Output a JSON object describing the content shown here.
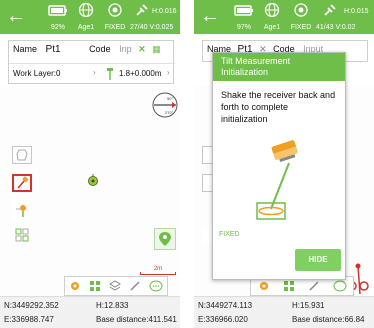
{
  "left": {
    "status": {
      "battery_pct": "92%",
      "age_label": "Age1",
      "fix_label": "FIXED",
      "sat_count": "27/40",
      "hrms": "H:0.016",
      "vrms": "V:0.025"
    },
    "form": {
      "name_label": "Name",
      "name_value": "Pt1",
      "code_label": "Code",
      "code_value": "Inp",
      "layer_label": "Work Layer:0",
      "height_value": "1.8+0.000m"
    },
    "compass": {
      "north": "90°",
      "south": "270°"
    },
    "scale": "2m",
    "coords": {
      "north": "N:3449292.352",
      "east": "E:336988.747",
      "height": "H:12.833",
      "base_distance": "Base distance:411.541"
    }
  },
  "right": {
    "status": {
      "battery_pct": "97%",
      "age_label": "Age1",
      "fix_label": "FIXED",
      "sat_count": "41/43",
      "hrms": "H:0.015",
      "vrms": "V:0.02"
    },
    "form": {
      "name_label": "Name",
      "name_value": "Pt1",
      "code_label": "Code",
      "code_value": "Input"
    },
    "dialog": {
      "title": "Tilt Measurement Initialization",
      "message": "Shake the receiver back and forth to complete initialization",
      "status": "FIXED",
      "hide_label": "HIDE"
    },
    "coords": {
      "north": "N:3449274.113",
      "east": "E:336966.020",
      "height": "H:15.931",
      "base_distance": "Base distance:66.84"
    }
  },
  "colors": {
    "accent": "#6fbe4a",
    "red": "#d0342c"
  }
}
